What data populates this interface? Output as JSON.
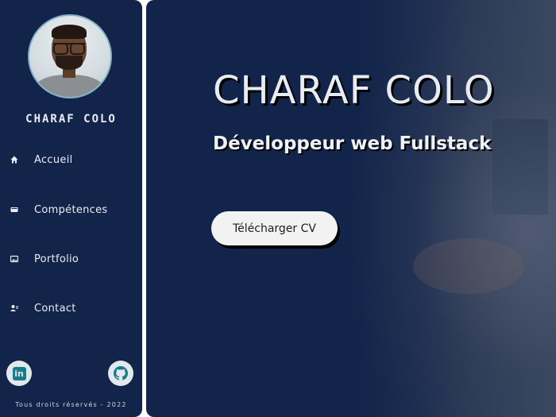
{
  "sidebar": {
    "name": "CHARAF COLO",
    "nav": [
      {
        "label": "Accueil",
        "icon": "home-icon"
      },
      {
        "label": "Compétences",
        "icon": "skills-icon"
      },
      {
        "label": "Portfolio",
        "icon": "image-icon"
      },
      {
        "label": "Contact",
        "icon": "contact-icon"
      }
    ],
    "social": [
      {
        "icon": "linkedin-icon",
        "label": "in"
      },
      {
        "icon": "github-icon"
      }
    ],
    "footer": "Tous droits réservés - 2022"
  },
  "hero": {
    "title": "CHARAF COLO",
    "subtitle": "Développeur web Fullstack",
    "cv_button": "Télécharger CV"
  },
  "colors": {
    "navy": "#13244a",
    "text": "#e9edf5",
    "button_bg": "#f2f2f2",
    "social_icon": "#1a7b8a"
  }
}
